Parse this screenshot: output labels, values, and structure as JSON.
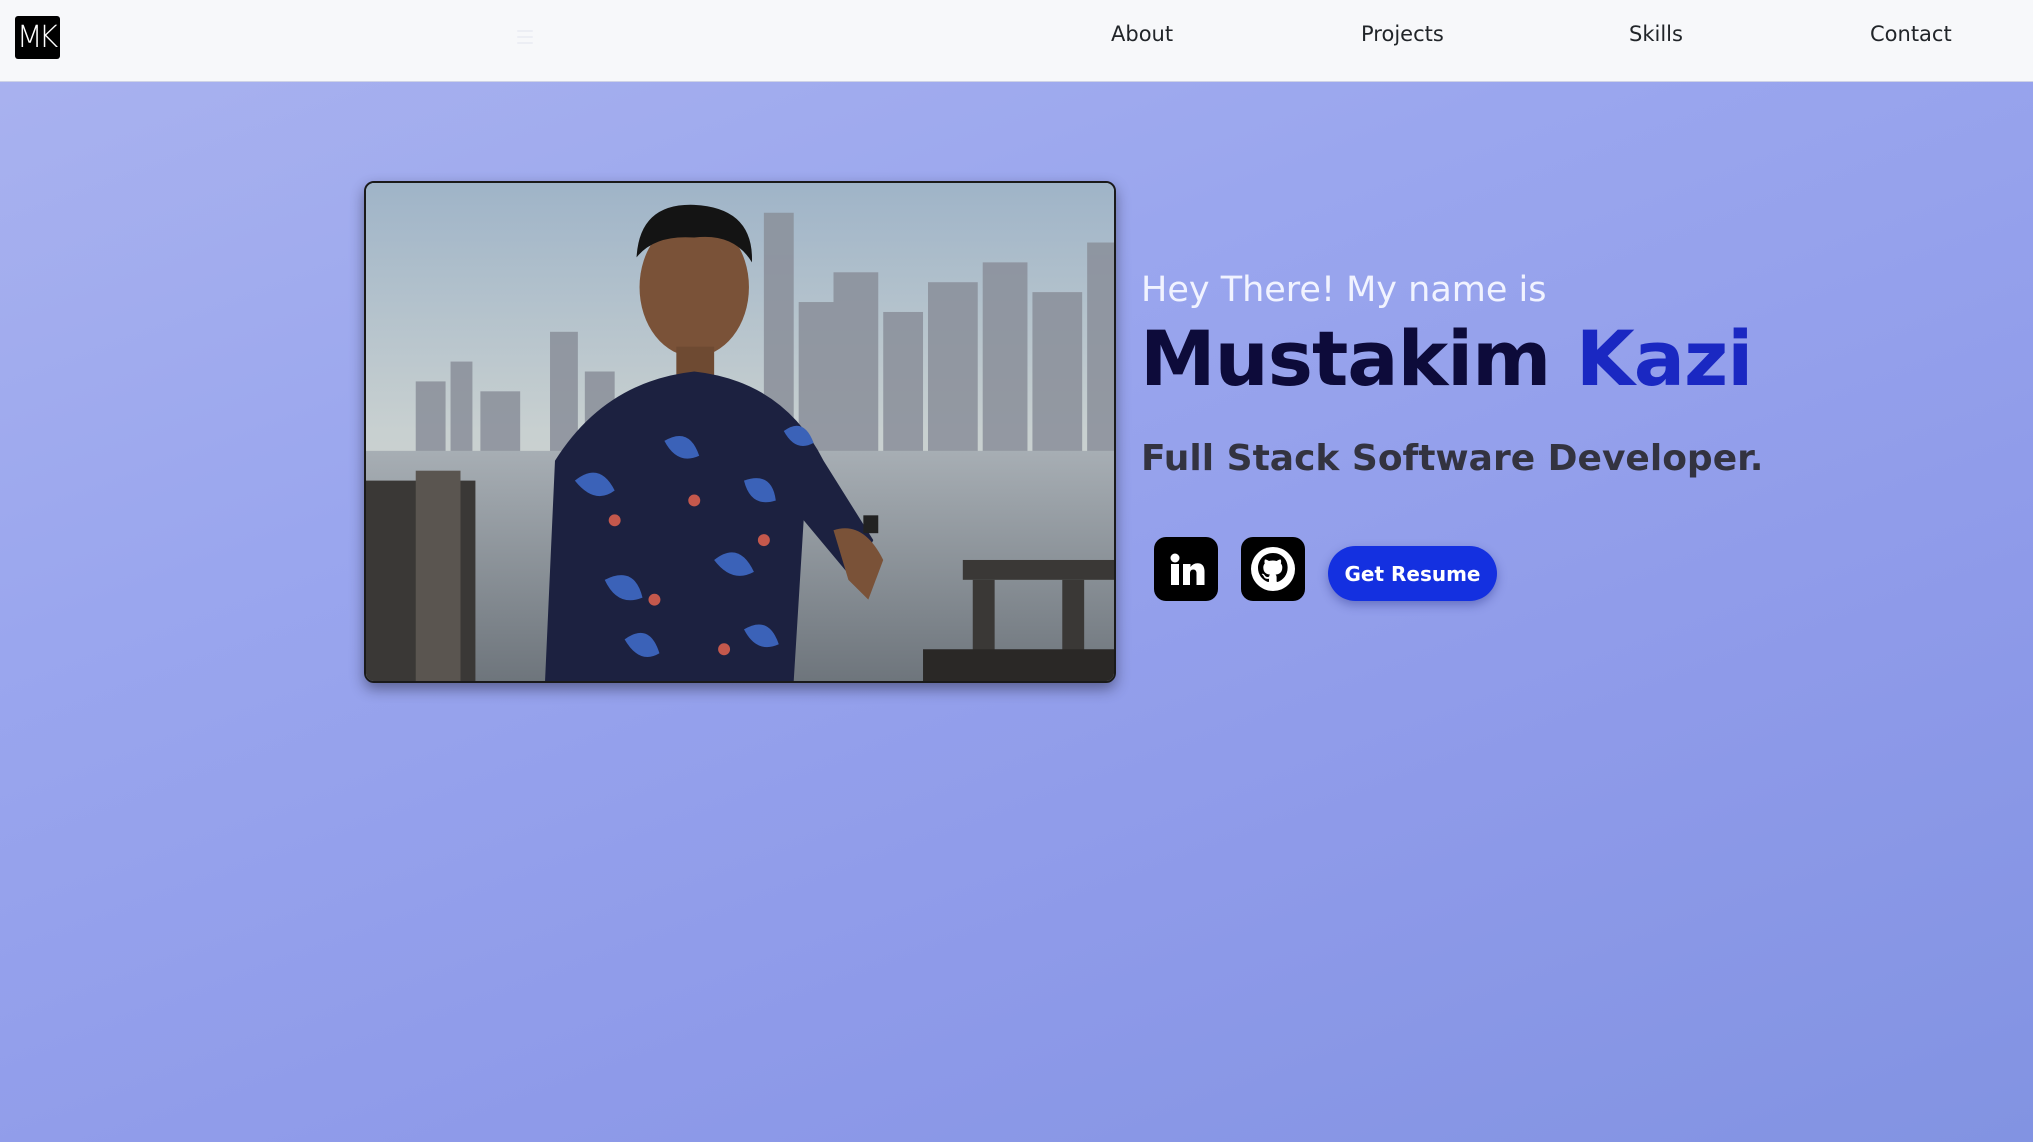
{
  "navbar": {
    "logo_text": "MK",
    "links": {
      "about": "About",
      "projects": "Projects",
      "skills": "Skills",
      "contact": "Contact"
    }
  },
  "hero": {
    "greeting": "Hey There! My name is",
    "first_name": "Mustakim",
    "last_name": "Kazi",
    "role": "Full Stack Software Developer.",
    "resume_label": "Get Resume",
    "social": [
      "linkedin-icon",
      "github-icon"
    ]
  },
  "colors": {
    "background": "#9aa6ee",
    "navbar": "#f7f8fa",
    "first_name": "#0d0b3a",
    "last_name": "#1a28c2",
    "button": "#1430e0"
  }
}
